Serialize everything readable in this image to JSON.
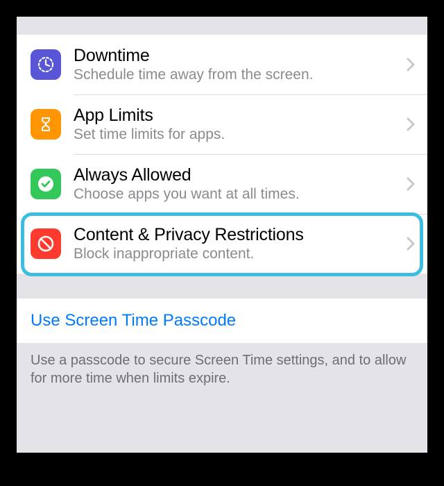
{
  "rows": [
    {
      "title": "Downtime",
      "subtitle": "Schedule time away from the screen.",
      "icon": "downtime-icon",
      "color": "#5856d6"
    },
    {
      "title": "App Limits",
      "subtitle": "Set time limits for apps.",
      "icon": "hourglass-icon",
      "color": "#ff9500"
    },
    {
      "title": "Always Allowed",
      "subtitle": "Choose apps you want at all times.",
      "icon": "check-icon",
      "color": "#34c759"
    },
    {
      "title": "Content & Privacy Restrictions",
      "subtitle": "Block inappropriate content.",
      "icon": "restrict-icon",
      "color": "#ff3b30"
    }
  ],
  "link": {
    "label": "Use Screen Time Passcode"
  },
  "footer": "Use a passcode to secure Screen Time settings, and to allow for more time when limits expire."
}
